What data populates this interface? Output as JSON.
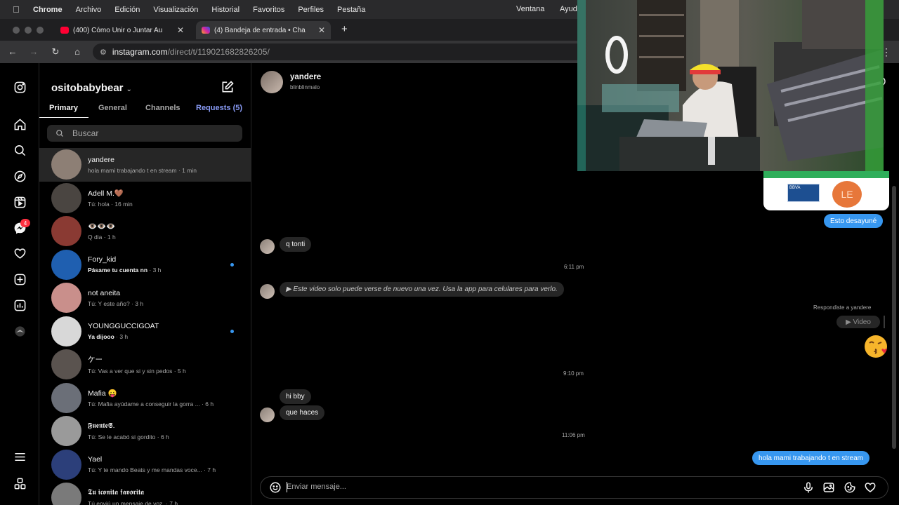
{
  "menubar": {
    "app": "Chrome",
    "items": [
      "Archivo",
      "Edición",
      "Visualización",
      "Historial",
      "Favoritos",
      "Perfiles",
      "Pestaña"
    ],
    "right_items": [
      "Ventana",
      "Ayud"
    ]
  },
  "browser": {
    "tabs": [
      {
        "title": "(400) Cómo Unir o Juntar Au",
        "favicon": "youtube-icon",
        "color": "#ff0033"
      },
      {
        "title": "(4) Bandeja de entrada • Cha",
        "favicon": "instagram-icon",
        "color": "#d6249f"
      }
    ],
    "url_host": "instagram.com",
    "url_path": "/direct/t/119021682826205/"
  },
  "rail": {
    "message_badge": "4"
  },
  "inbox": {
    "account": "ositobabybear",
    "tabs": [
      "Primary",
      "General",
      "Channels",
      "Requests (5)"
    ],
    "search_placeholder": "Buscar",
    "threads": [
      {
        "name": "yandere",
        "preview": "hola mami trabajando t en stream",
        "time": " · 1 min",
        "unread": false,
        "selected": true,
        "avatar": "#8d7f75"
      },
      {
        "name": "Adell M.🤎",
        "preview": "Tú: hola",
        "time": " · 16 min",
        "unread": false,
        "selected": false,
        "avatar": "#4a4541"
      },
      {
        "name": "👁️👁️👁️",
        "preview": "Q dia",
        "time": " · 1 h",
        "unread": false,
        "selected": false,
        "avatar": "#8a3a33"
      },
      {
        "name": "Fory_kid",
        "preview": "Pásame tu cuenta nn",
        "time": " · 3 h",
        "unread": true,
        "selected": false,
        "avatar": "#1f5fb0"
      },
      {
        "name": "not aneita",
        "preview": "Tú: Y este año?",
        "time": " · 3 h",
        "unread": false,
        "selected": false,
        "avatar": "#c98f8b"
      },
      {
        "name": "YOUNGGUCCIGOAT",
        "preview": "Ya dijooo",
        "time": " · 3 h",
        "unread": true,
        "selected": false,
        "avatar": "#d8d8d8"
      },
      {
        "name": "ケー",
        "preview": "Tú: Vas a ver que si y sin pedos",
        "time": " · 5 h",
        "unread": false,
        "selected": false,
        "avatar": "#5a534f"
      },
      {
        "name": "Mafia 😛",
        "preview": "Tú: Mafia ayúdame a conseguir la gorra ...",
        "time": " · 6 h",
        "unread": false,
        "selected": false,
        "avatar": "#6b6f78"
      },
      {
        "name": "𝕱𝖚𝖊𝖓𝖙𝖊𝕾.",
        "preview": "Tú: Se le acabó si gordito",
        "time": " · 6 h",
        "unread": false,
        "selected": false,
        "avatar": "#9a9a9a"
      },
      {
        "name": "Yael",
        "preview": "Tú: Y te mando Beats y me mandas voce...",
        "time": " · 7 h",
        "unread": false,
        "selected": false,
        "avatar": "#2c3f7a"
      },
      {
        "name": "𝕿𝖚 𝖎𝖈𝖔𝖓𝖎𝖙𝖆 𝖋𝖆𝖛𝖔𝖗𝖎𝖙𝖆",
        "preview": "Tú enviú un mensaje de voz.",
        "time": " · 7 h",
        "unread": false,
        "selected": false,
        "avatar": "#7a7a7a"
      }
    ]
  },
  "chat": {
    "name": "yandere",
    "username": "blinblinmalo",
    "messages": {
      "sent_caption": "Esto desayuné",
      "q_tonti": "q tonti",
      "ts1": "6:11 pm",
      "video_notice": "▶ Este video solo puede verse de nuevo una vez. Usa la app para celulares para verlo.",
      "replied_label": "Respondiste a yandere",
      "video_pill": "▶ Video",
      "ts2": "9:10 pm",
      "hi_bby": "hi bby",
      "que_haces": "que haces",
      "ts3": "11:06 pm",
      "last_sent": "hola mami trabajando t en stream"
    },
    "card_text": "LE",
    "card_brand": "BBVA",
    "composer_placeholder": "Enviar mensaje..."
  },
  "colors": {
    "accent": "#3797f0",
    "requests": "#8a9cf8",
    "badge": "#ff3040"
  }
}
